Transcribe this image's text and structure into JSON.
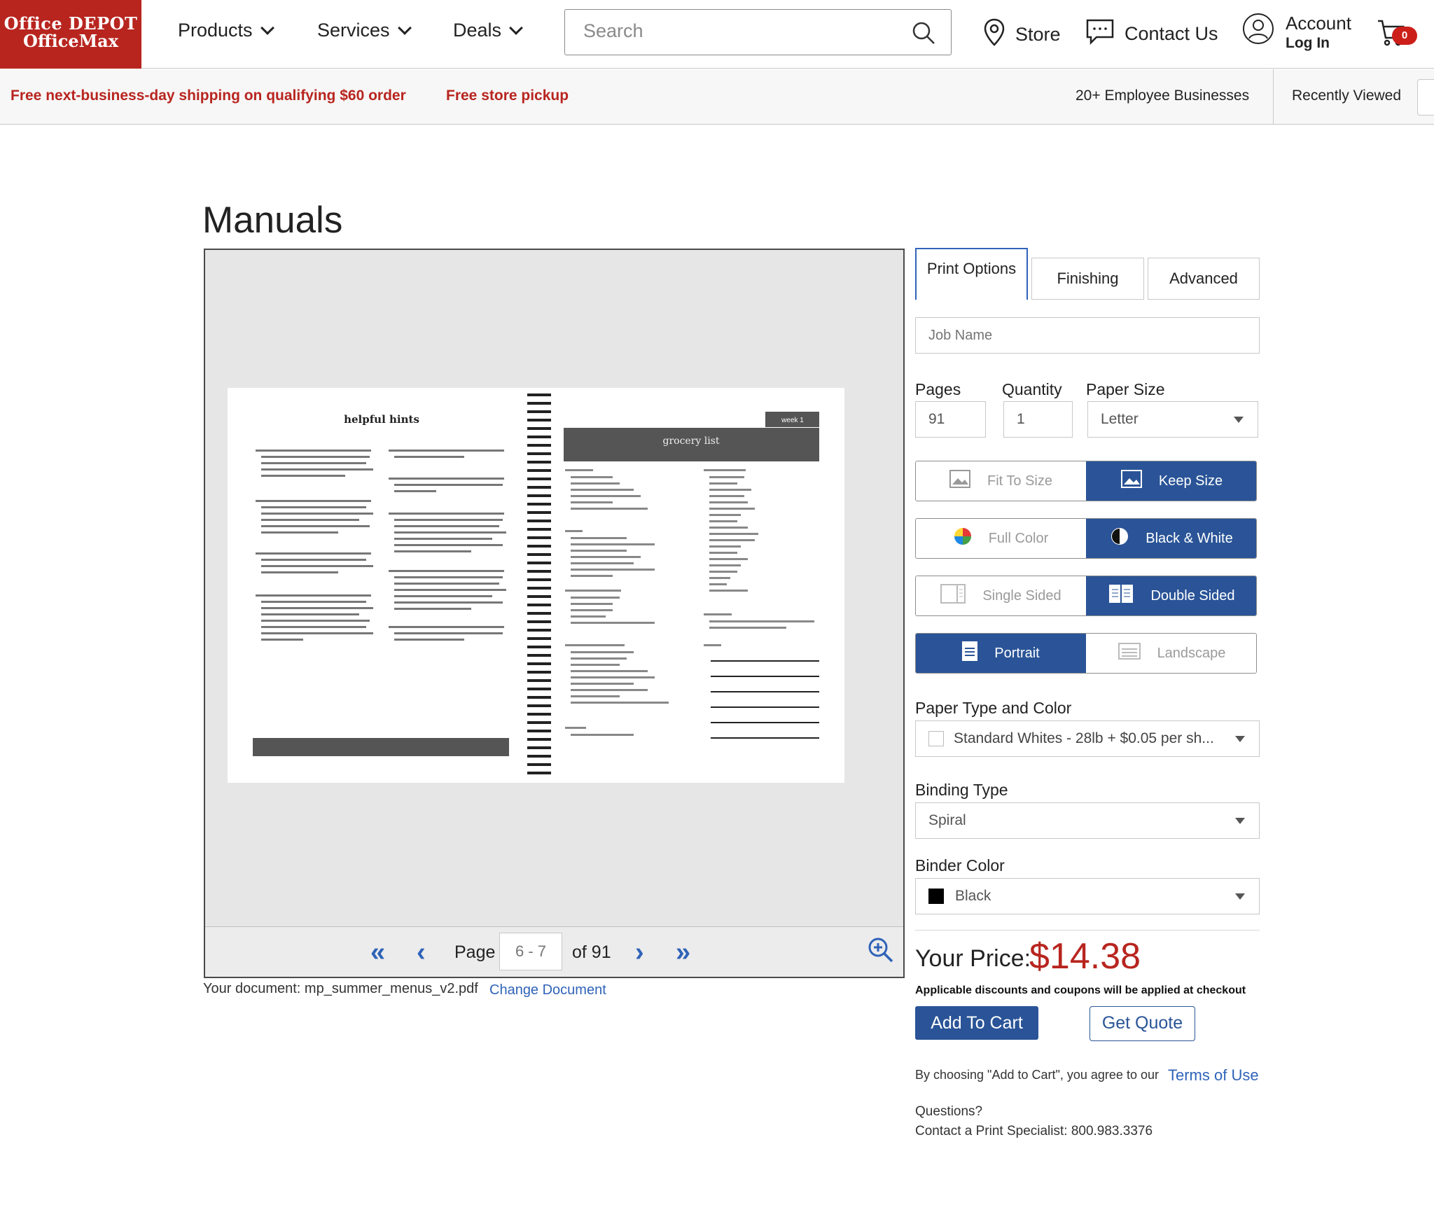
{
  "header": {
    "logo_line1": "Office DEPOT",
    "logo_line2": "OfficeMax",
    "nav": [
      {
        "label": "Products"
      },
      {
        "label": "Services"
      },
      {
        "label": "Deals"
      }
    ],
    "search_placeholder": "Search",
    "store_label": "Store",
    "contact_label": "Contact Us",
    "account_label": "Account",
    "login_label": "Log In",
    "cart_count": "0"
  },
  "promo": {
    "shipping": "Free next-business-day shipping on qualifying $60 order",
    "pickup": "Free store pickup",
    "business": "20+ Employee Businesses",
    "recent": "Recently Viewed"
  },
  "page": {
    "title": "Manuals"
  },
  "preview": {
    "page_label": "Page",
    "page_value": "6 - 7",
    "of_label": "of 91",
    "document_line": "Your document: mp_summer_menus_v2.pdf",
    "change_document": "Change Document",
    "left_heading": "helpful hints",
    "right_heading": "grocery list",
    "right_tag": "week 1"
  },
  "options": {
    "tabs": [
      {
        "label": "Print Options"
      },
      {
        "label": "Finishing"
      },
      {
        "label": "Advanced"
      }
    ],
    "job_name_placeholder": "Job Name",
    "pages_label": "Pages",
    "pages_value": "91",
    "quantity_label": "Quantity",
    "quantity_value": "1",
    "paper_size_label": "Paper Size",
    "paper_size_value": "Letter",
    "fit_to_size": "Fit To Size",
    "keep_size": "Keep Size",
    "full_color": "Full Color",
    "black_white": "Black & White",
    "single_sided": "Single Sided",
    "double_sided": "Double Sided",
    "portrait": "Portrait",
    "landscape": "Landscape",
    "paper_type_label": "Paper Type and Color",
    "paper_type_value": "Standard Whites - 28lb + $0.05 per sh...",
    "binding_label": "Binding Type",
    "binding_value": "Spiral",
    "binder_color_label": "Binder Color",
    "binder_color_value": "Black",
    "price_label": "Your Price:",
    "price_value": "$14.38",
    "discount_note": "Applicable discounts and coupons will be applied at checkout",
    "add_to_cart": "Add To Cart",
    "get_quote": "Get Quote",
    "agree_text": "By choosing \"Add to Cart\", you agree to our",
    "terms": "Terms of Use",
    "questions": "Questions?",
    "contact_specialist": "Contact a Print Specialist: 800.983.3376"
  },
  "colors": {
    "brand_red": "#b8251f",
    "accent_blue": "#2a5497",
    "link_blue": "#2f63b8"
  }
}
